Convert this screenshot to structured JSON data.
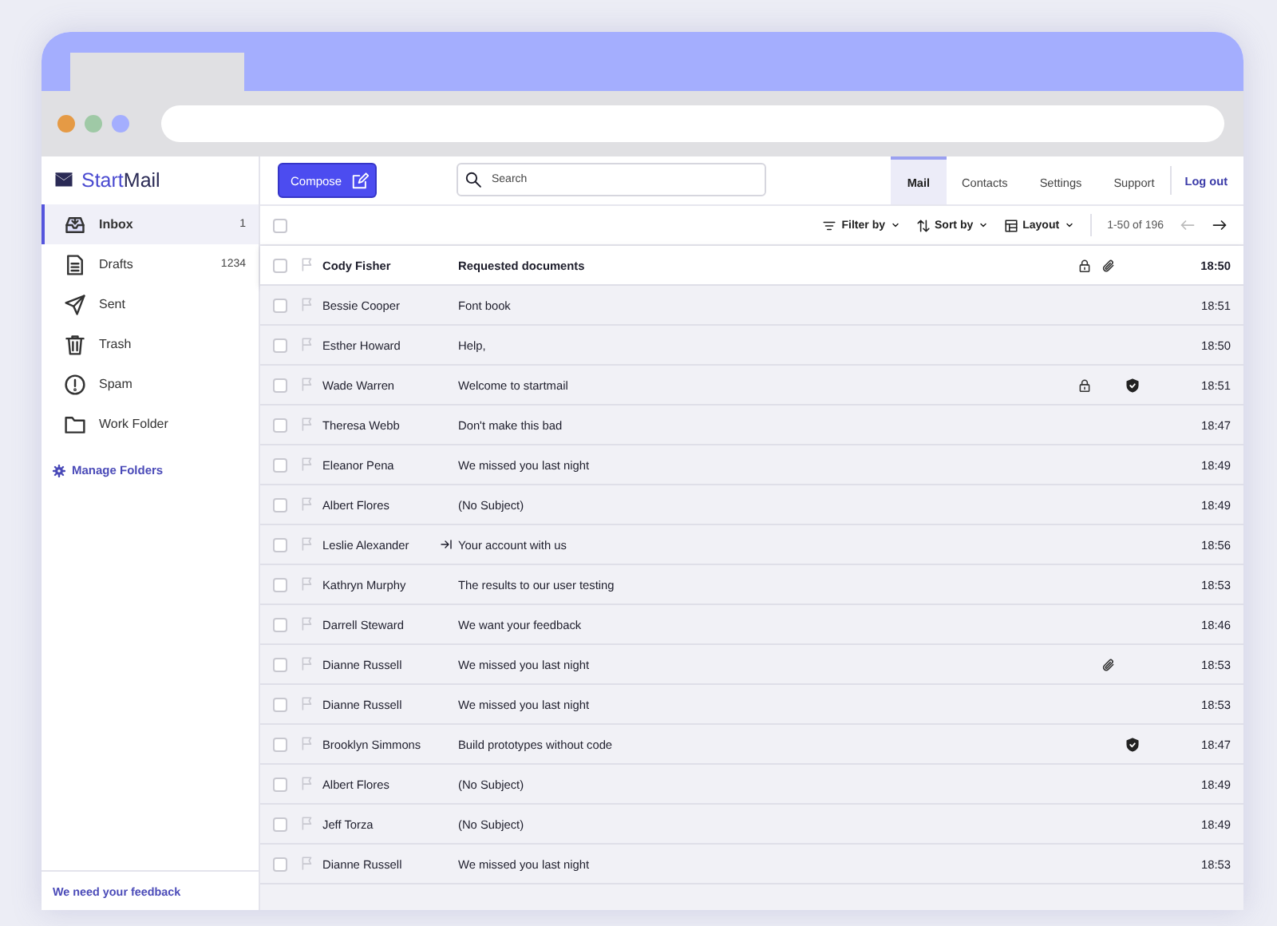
{
  "brand": {
    "name_light": "Start",
    "name_bold": "Mail"
  },
  "compose": {
    "label": "Compose"
  },
  "search": {
    "placeholder": "Search"
  },
  "nav": [
    {
      "label": "Mail",
      "selected": true
    },
    {
      "label": "Contacts",
      "selected": false
    },
    {
      "label": "Settings",
      "selected": false
    },
    {
      "label": "Support",
      "selected": false
    }
  ],
  "logout": "Log out",
  "sidebar": {
    "items": [
      {
        "kind": "inbox",
        "label": "Inbox",
        "count": "1",
        "selected": true
      },
      {
        "kind": "drafts",
        "label": "Drafts",
        "count": "1234",
        "selected": false
      },
      {
        "kind": "sent",
        "label": "Sent",
        "selected": false
      },
      {
        "kind": "trash",
        "label": "Trash",
        "selected": false
      },
      {
        "kind": "spam",
        "label": "Spam",
        "selected": false
      },
      {
        "kind": "folder",
        "label": "Work Folder",
        "selected": false
      }
    ],
    "manage": "Manage Folders",
    "feedback": "We need your feedback"
  },
  "toolbar": {
    "select_all_checked": false,
    "filter": "Filter by",
    "sort": "Sort by",
    "layout": "Layout",
    "range": "1-50 of 196"
  },
  "messages": [
    {
      "sender": "Cody Fisher",
      "subject": "Requested documents",
      "time": "18:50",
      "unread": true,
      "locked": true,
      "attachment": true,
      "verified": false,
      "forwarded": false
    },
    {
      "sender": "Bessie Cooper",
      "subject": "Font book",
      "time": "18:51",
      "unread": false,
      "locked": false,
      "attachment": false,
      "verified": false,
      "forwarded": false
    },
    {
      "sender": "Esther Howard",
      "subject": "Help,",
      "time": "18:50",
      "unread": false,
      "locked": false,
      "attachment": false,
      "verified": false,
      "forwarded": false
    },
    {
      "sender": "Wade Warren",
      "subject": "Welcome to startmail",
      "time": "18:51",
      "unread": false,
      "locked": true,
      "attachment": false,
      "verified": true,
      "forwarded": false
    },
    {
      "sender": "Theresa Webb",
      "subject": "Don't make this bad",
      "time": "18:47",
      "unread": false,
      "locked": false,
      "attachment": false,
      "verified": false,
      "forwarded": false
    },
    {
      "sender": "Eleanor Pena",
      "subject": "We missed you last night",
      "time": "18:49",
      "unread": false,
      "locked": false,
      "attachment": false,
      "verified": false,
      "forwarded": false
    },
    {
      "sender": "Albert Flores",
      "subject": "(No Subject)",
      "time": "18:49",
      "unread": false,
      "locked": false,
      "attachment": false,
      "verified": false,
      "forwarded": false
    },
    {
      "sender": "Leslie Alexander",
      "subject": "Your account with us",
      "time": "18:56",
      "unread": false,
      "locked": false,
      "attachment": false,
      "verified": false,
      "forwarded": true
    },
    {
      "sender": "Kathryn Murphy",
      "subject": "The results to our user testing",
      "time": "18:53",
      "unread": false,
      "locked": false,
      "attachment": false,
      "verified": false,
      "forwarded": false
    },
    {
      "sender": "Darrell Steward",
      "subject": "We want your feedback",
      "time": "18:46",
      "unread": false,
      "locked": false,
      "attachment": false,
      "verified": false,
      "forwarded": false
    },
    {
      "sender": "Dianne Russell",
      "subject": "We missed you last night",
      "time": "18:53",
      "unread": false,
      "locked": false,
      "attachment": true,
      "verified": false,
      "forwarded": false
    },
    {
      "sender": "Dianne Russell",
      "subject": "We missed you last night",
      "time": "18:53",
      "unread": false,
      "locked": false,
      "attachment": false,
      "verified": false,
      "forwarded": false
    },
    {
      "sender": "Brooklyn Simmons",
      "subject": "Build prototypes without code",
      "time": "18:47",
      "unread": false,
      "locked": false,
      "attachment": false,
      "verified": true,
      "forwarded": false
    },
    {
      "sender": "Albert Flores",
      "subject": "(No Subject)",
      "time": "18:49",
      "unread": false,
      "locked": false,
      "attachment": false,
      "verified": false,
      "forwarded": false
    },
    {
      "sender": "Jeff Torza",
      "subject": "(No Subject)",
      "time": "18:49",
      "unread": false,
      "locked": false,
      "attachment": false,
      "verified": false,
      "forwarded": false
    },
    {
      "sender": "Dianne Russell",
      "subject": "We missed you last night",
      "time": "18:53",
      "unread": false,
      "locked": false,
      "attachment": false,
      "verified": false,
      "forwarded": false
    }
  ]
}
